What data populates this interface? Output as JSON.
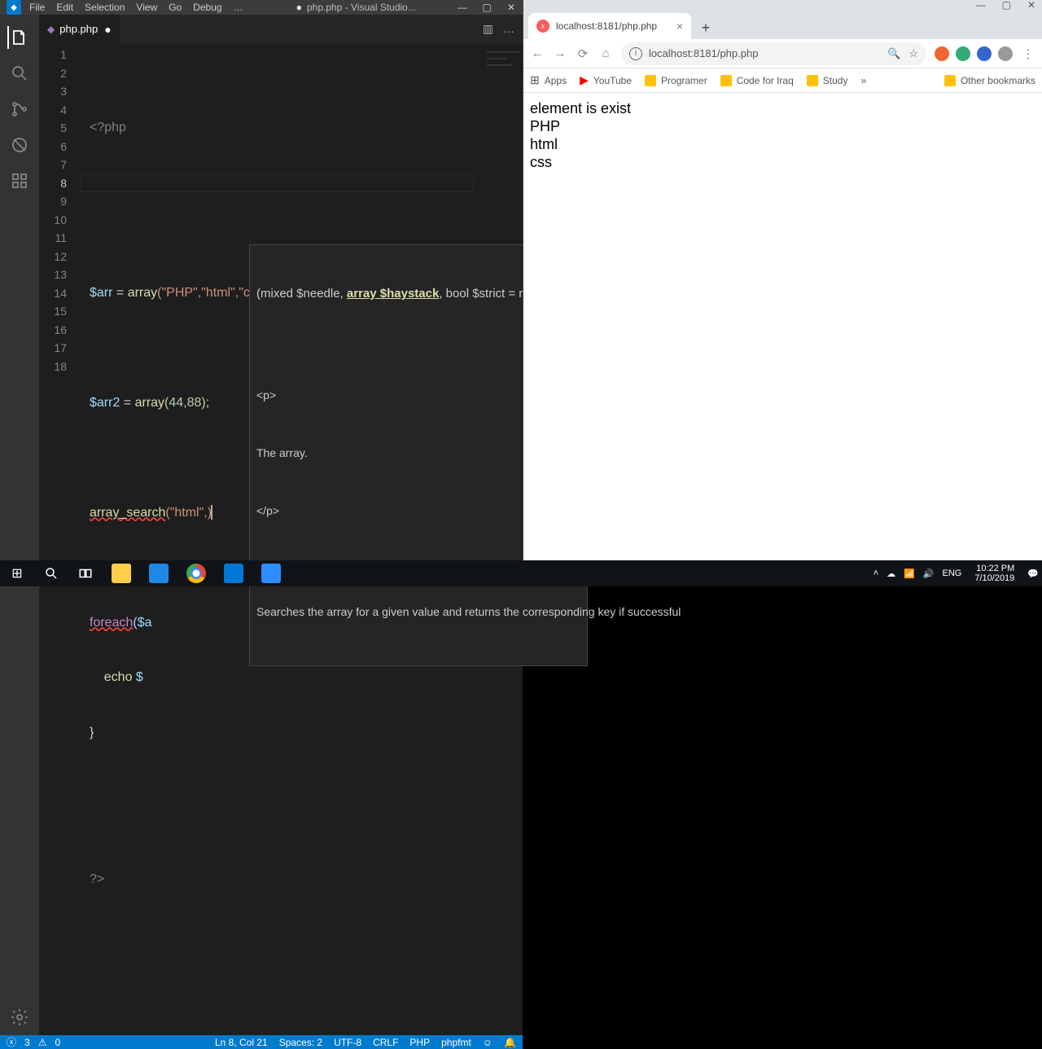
{
  "vscode": {
    "menu": [
      "File",
      "Edit",
      "Selection",
      "View",
      "Go",
      "Debug",
      "…"
    ],
    "title": "php.php - Visual Studio...",
    "win_controls": {
      "min": "—",
      "max": "▢",
      "close": "✕"
    },
    "tab": {
      "icon": "●",
      "name": "php.php",
      "dirty": "●"
    },
    "tab_actions": {
      "split": "▥",
      "more": "…"
    },
    "lines": [
      "1",
      "2",
      "3",
      "4",
      "5",
      "6",
      "7",
      "8",
      "9",
      "10",
      "11",
      "12",
      "13",
      "14",
      "15",
      "16",
      "17",
      "18"
    ],
    "code": {
      "l1_open": "<?php",
      "l4_var": "$arr",
      "l4_eq": " = ",
      "l4_fn": "array",
      "l4_args": "(\"PHP\",\"html\",\"css\");",
      "l6_var": "$arr2",
      "l6_eq": " = ",
      "l6_fn": "array",
      "l6_args": "(44,88);",
      "l8_fn": "array_search",
      "l8_args": "(\"html\",)",
      "l10_kw": "foreach",
      "l10_rest": "($a",
      "l11_echo": "    echo ",
      "l11_rest": "$",
      "l12": "}",
      "l16": "?>"
    },
    "tooltip": {
      "sig_pre": "(mixed $needle, ",
      "sig_active": "array $haystack",
      "sig_post": ", bool $strict = null)",
      "doc_p_open": "<p>",
      "doc_text": "The array.",
      "doc_p_close": "</p>",
      "desc": "Searches the array for a given value and returns the corresponding key if successful"
    },
    "status": {
      "errors_icon": "ⓧ",
      "errors": "3",
      "warnings_icon": "⚠",
      "warnings": "0",
      "lncol": "Ln 8, Col 21",
      "spaces": "Spaces: 2",
      "enc": "UTF-8",
      "eol": "CRLF",
      "lang": "PHP",
      "fmt": "phpfmt",
      "face": "☺",
      "bell": "🔔"
    }
  },
  "browser": {
    "win": {
      "min": "—",
      "max": "▢",
      "close": "✕"
    },
    "tab": {
      "title": "localhost:8181/php.php",
      "close": "×"
    },
    "newtab": "+",
    "nav": {
      "back": "←",
      "fwd": "→",
      "reload": "⟳",
      "home": "⌂"
    },
    "url": "localhost:8181/php.php",
    "addr_icons": {
      "zoom": "🔍",
      "star": "☆"
    },
    "exts": [
      "ext1",
      "ext2",
      "ext3",
      "ext4"
    ],
    "menu": "⋮",
    "bookmarks": [
      {
        "icon": "⊞",
        "label": "Apps"
      },
      {
        "icon": "▶",
        "label": "YouTube"
      },
      {
        "icon": "📁",
        "label": "Programer"
      },
      {
        "icon": "📁",
        "label": "Code for Iraq"
      },
      {
        "icon": "📁",
        "label": "Study"
      }
    ],
    "bm_more": "»",
    "bm_other": "Other bookmarks",
    "page_lines": [
      "element is exist",
      "PHP",
      "html",
      "css"
    ]
  },
  "taskbar": {
    "start": "⊞",
    "search": "🔍",
    "apps": [
      "explorer",
      "edge",
      "chrome",
      "vscode",
      "zoom"
    ],
    "tray": {
      "up": "˄",
      "cloud": "☁",
      "wifi": "📶",
      "vol": "🔊",
      "lang": "ENG",
      "time": "10:22 PM",
      "date": "7/10/2019",
      "notif": "💬"
    }
  }
}
